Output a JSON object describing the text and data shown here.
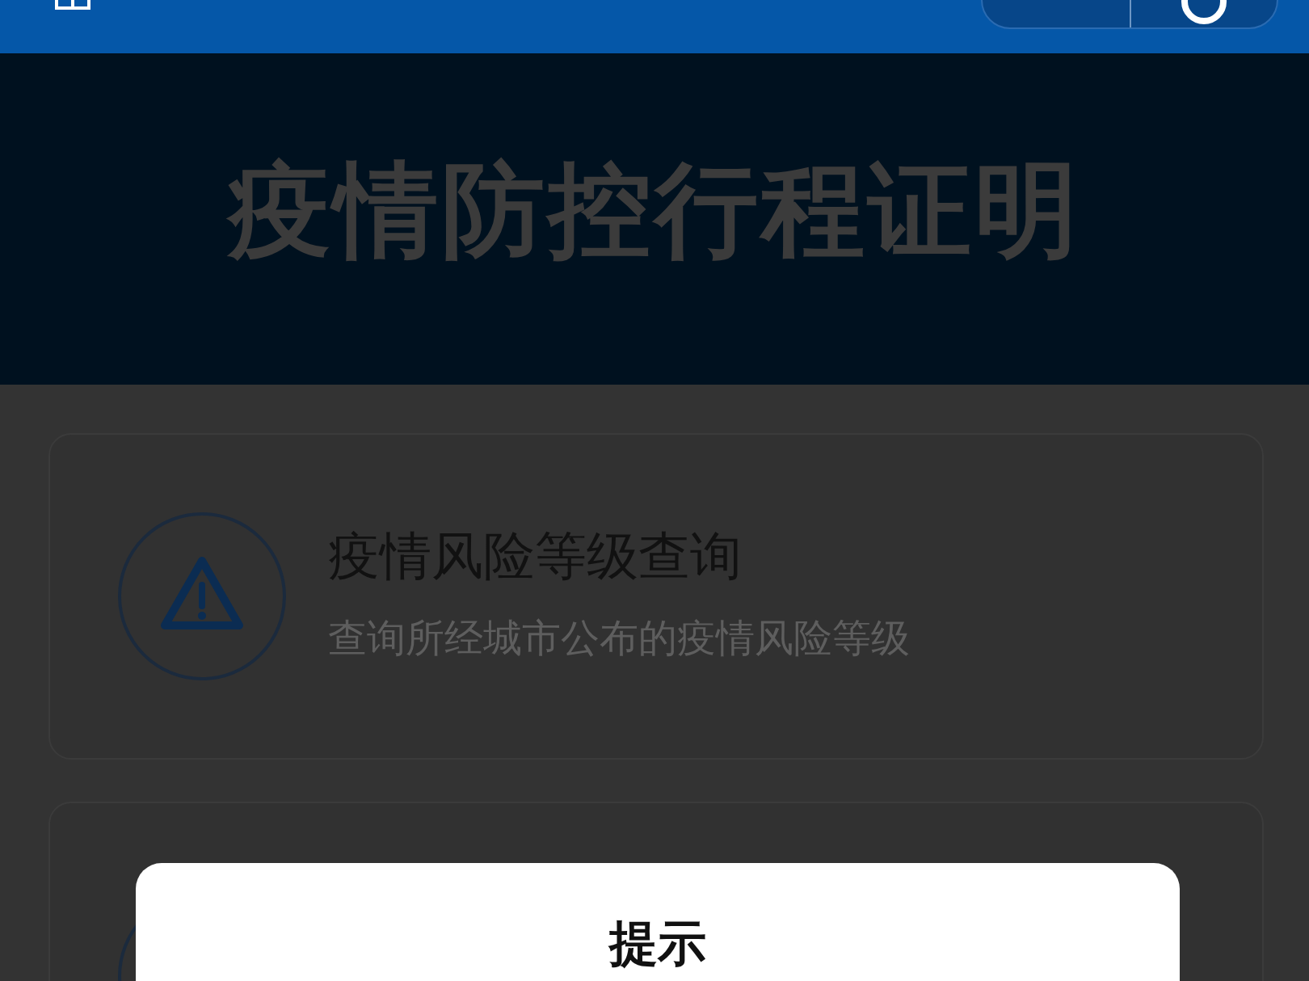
{
  "header": {
    "title": "疫情防控行程证明"
  },
  "cards": [
    {
      "title": "疫情风险等级查询",
      "subtitle": "查询所经城市公布的疫情风险等级"
    }
  ],
  "dialog": {
    "title": "提示"
  }
}
